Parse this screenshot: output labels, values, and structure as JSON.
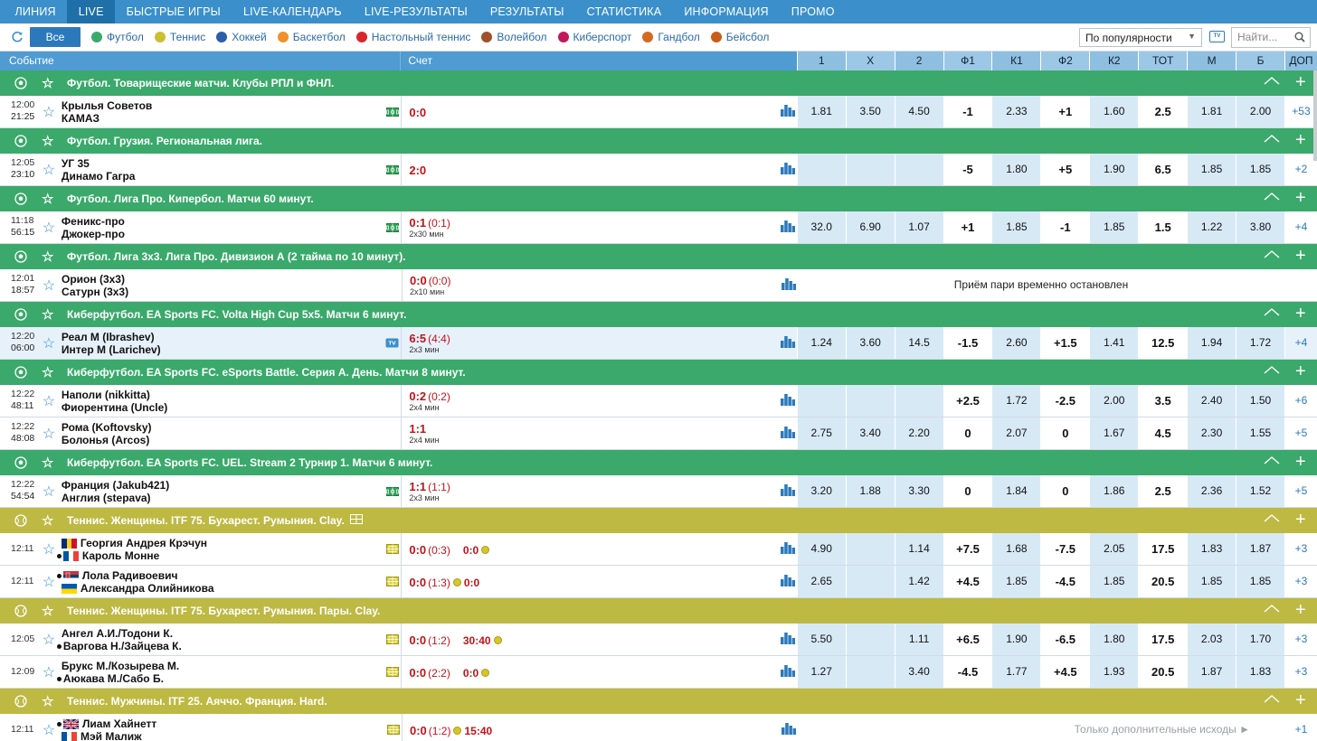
{
  "nav": {
    "items": [
      "ЛИНИЯ",
      "LIVE",
      "БЫСТРЫЕ ИГРЫ",
      "LIVE-КАЛЕНДАРЬ",
      "LIVE-РЕЗУЛЬТАТЫ",
      "РЕЗУЛЬТАТЫ",
      "СТАТИСТИКА",
      "ИНФОРМАЦИЯ",
      "ПРОМО"
    ],
    "active_index": 1
  },
  "filters": {
    "all_label": "Все",
    "sports": [
      {
        "label": "Футбол",
        "icon": "football-icon",
        "color": "#3aa96b"
      },
      {
        "label": "Теннис",
        "icon": "tennis-icon",
        "color": "#c8c032"
      },
      {
        "label": "Хоккей",
        "icon": "hockey-icon",
        "color": "#2b5ea8"
      },
      {
        "label": "Баскетбол",
        "icon": "basketball-icon",
        "color": "#f0902a"
      },
      {
        "label": "Настольный теннис",
        "icon": "table-tennis-icon",
        "color": "#d8262d"
      },
      {
        "label": "Волейбол",
        "icon": "volleyball-icon",
        "color": "#a0502a"
      },
      {
        "label": "Киберспорт",
        "icon": "esports-icon",
        "color": "#c2185b"
      },
      {
        "label": "Гандбол",
        "icon": "handball-icon",
        "color": "#d36a1f"
      },
      {
        "label": "Бейсбол",
        "icon": "baseball-icon",
        "color": "#c75d19"
      }
    ],
    "sort_value": "По популярности",
    "search_placeholder": "Найти...",
    "tv_label": "TV"
  },
  "columns": {
    "event": "Событие",
    "score": "Счет",
    "odds": [
      "1",
      "X",
      "2",
      "Ф1",
      "К1",
      "Ф2",
      "К2",
      "ТОТ",
      "М",
      "Б"
    ],
    "dop": "ДОП"
  },
  "groups": [
    {
      "type": "football",
      "title": "Футбол. Товарищеские матчи. Клубы РПЛ и ФНЛ.",
      "rows": [
        {
          "t1": "12:00",
          "t2": "21:25",
          "team1": "Крылья Советов",
          "team2": "КАМАЗ",
          "score": "0:0",
          "score_extra": "",
          "sub": "",
          "icon": "field",
          "odds": [
            "1.81",
            "3.50",
            "4.50",
            "-1",
            "2.33",
            "+1",
            "1.60",
            "2.5",
            "1.81",
            "2.00"
          ],
          "dop": "+53"
        }
      ]
    },
    {
      "type": "football",
      "title": "Футбол. Грузия. Региональная лига.",
      "rows": [
        {
          "t1": "12:05",
          "t2": "23:10",
          "team1": "УГ 35",
          "team2": "Динамо Гагра",
          "score": "2:0",
          "score_extra": "",
          "sub": "",
          "icon": "field",
          "odds": [
            "",
            "",
            "",
            "-5",
            "1.80",
            "+5",
            "1.90",
            "6.5",
            "1.85",
            "1.85"
          ],
          "dop": "+2"
        }
      ]
    },
    {
      "type": "football",
      "title": "Футбол. Лига Про. Кипербол. Матчи 60 минут.",
      "rows": [
        {
          "t1": "11:18",
          "t2": "56:15",
          "team1": "Феникс-про",
          "team2": "Джокер-про",
          "score": "0:1",
          "score_extra": "(0:1)",
          "sub": "2x30 мин",
          "icon": "field",
          "odds": [
            "32.0",
            "6.90",
            "1.07",
            "+1",
            "1.85",
            "-1",
            "1.85",
            "1.5",
            "1.22",
            "3.80"
          ],
          "dop": "+4"
        }
      ]
    },
    {
      "type": "football",
      "title": "Футбол. Лига 3х3. Лига Про. Дивизион А (2 тайма по 10 минут).",
      "rows": [
        {
          "t1": "12:01",
          "t2": "18:57",
          "team1": "Орион (3х3)",
          "team2": "Сатурн (3х3)",
          "score": "0:0",
          "score_extra": "(0:0)",
          "sub": "2x10 мин",
          "icon": "",
          "message": "Приём пари временно остановлен",
          "dop": ""
        }
      ]
    },
    {
      "type": "football",
      "title": "Киберфутбол. EA Sports FC. Volta High Cup 5x5. Матчи 6 минут.",
      "rows": [
        {
          "t1": "12:20",
          "t2": "06:00",
          "team1": "Реал М (Ibrashev)",
          "team2": "Интер М (Larichev)",
          "score": "6:5",
          "score_extra": "(4:4)",
          "sub": "2x3 мин",
          "icon": "tv",
          "highlight": true,
          "odds": [
            "1.24",
            "3.60",
            "14.5",
            "-1.5",
            "2.60",
            "+1.5",
            "1.41",
            "12.5",
            "1.94",
            "1.72"
          ],
          "dop": "+4"
        }
      ]
    },
    {
      "type": "football",
      "title": "Киберфутбол. EA Sports FC. eSports Battle. Серия А. День. Матчи 8 минут.",
      "rows": [
        {
          "t1": "12:22",
          "t2": "48:11",
          "team1": "Наполи (nikkitta)",
          "team2": "Фиорентина (Uncle)",
          "score": "0:2",
          "score_extra": "(0:2)",
          "sub": "2x4 мин",
          "icon": "",
          "odds": [
            "",
            "",
            "",
            "+2.5",
            "1.72",
            "-2.5",
            "2.00",
            "3.5",
            "2.40",
            "1.50"
          ],
          "dop": "+6"
        },
        {
          "t1": "12:22",
          "t2": "48:08",
          "team1": "Рома (Koftovsky)",
          "team2": "Болонья (Arcos)",
          "score": "1:1",
          "score_extra": "",
          "sub": "2x4 мин",
          "icon": "",
          "odds": [
            "2.75",
            "3.40",
            "2.20",
            "0",
            "2.07",
            "0",
            "1.67",
            "4.5",
            "2.30",
            "1.55"
          ],
          "dop": "+5"
        }
      ]
    },
    {
      "type": "football",
      "title": "Киберфутбол. EA Sports FC. UEL. Stream 2 Турнир 1. Матчи 6 минут.",
      "rows": [
        {
          "t1": "12:22",
          "t2": "54:54",
          "team1": "Франция (Jakub421)",
          "team2": "Англия (stepava)",
          "score": "1:1",
          "score_extra": "(1:1)",
          "sub": "2x3 мин",
          "icon": "field",
          "odds": [
            "3.20",
            "1.88",
            "3.30",
            "0",
            "1.84",
            "0",
            "1.86",
            "2.5",
            "2.36",
            "1.52"
          ],
          "dop": "+5"
        }
      ]
    },
    {
      "type": "tennis",
      "title": "Теннис. Женщины. ITF 75. Бухарест. Румыния. Clay.",
      "rows": [
        {
          "t1": "12:11",
          "t2": "",
          "team1": "Георгия Андрея Крэчун",
          "team2": "Кароль Монне",
          "flag1": "ro",
          "flag2": "fr",
          "serve": 2,
          "score": "0:0",
          "score_extra": "(0:3)",
          "game": "0:0",
          "game_ball": true,
          "sub": "",
          "icon": "court",
          "odds": [
            "4.90",
            "",
            "1.14",
            "+7.5",
            "1.68",
            "-7.5",
            "2.05",
            "17.5",
            "1.83",
            "1.87"
          ],
          "dop": "+3"
        },
        {
          "t1": "12:11",
          "t2": "",
          "team1": "Лола Радивоевич",
          "team2": "Александра Олийникова",
          "flag1": "rs",
          "flag2": "ua",
          "serve": 1,
          "score": "0:0",
          "score_extra": "(1:3)",
          "game": "0:0",
          "game_ball_before": true,
          "sub": "",
          "icon": "court",
          "odds": [
            "2.65",
            "",
            "1.42",
            "+4.5",
            "1.85",
            "-4.5",
            "1.85",
            "20.5",
            "1.85",
            "1.85"
          ],
          "dop": "+3"
        }
      ]
    },
    {
      "type": "tennis",
      "title": "Теннис. Женщины. ITF 75. Бухарест. Румыния. Пары. Clay.",
      "rows": [
        {
          "t1": "12:05",
          "t2": "",
          "team1": "Ангел А.И./Тодони К.",
          "team2": "Варгова Н./Зайцева К.",
          "serve": 2,
          "score": "0:0",
          "score_extra": "(1:2)",
          "game": "30:40",
          "game_ball": true,
          "sub": "",
          "icon": "court",
          "odds": [
            "5.50",
            "",
            "1.11",
            "+6.5",
            "1.90",
            "-6.5",
            "1.80",
            "17.5",
            "2.03",
            "1.70"
          ],
          "dop": "+3"
        },
        {
          "t1": "12:09",
          "t2": "",
          "team1": "Брукс М./Козырева М.",
          "team2": "Аюкава М./Сабо Б.",
          "serve": 2,
          "score": "0:0",
          "score_extra": "(2:2)",
          "game": "0:0",
          "game_ball": true,
          "sub": "",
          "icon": "court",
          "odds": [
            "1.27",
            "",
            "3.40",
            "-4.5",
            "1.77",
            "+4.5",
            "1.93",
            "20.5",
            "1.87",
            "1.83"
          ],
          "dop": "+3"
        }
      ]
    },
    {
      "type": "tennis",
      "title": "Теннис. Мужчины. ITF 25. Аяччо. Франция. Hard.",
      "rows": [
        {
          "t1": "12:11",
          "t2": "",
          "team1": "Лиам Хайнетт",
          "team2": "Мэй Малиж",
          "flag1": "gb",
          "flag2": "fr",
          "serve": 1,
          "score": "0:0",
          "score_extra": "(1:2)",
          "game": "15:40",
          "game_ball_before": true,
          "sub": "",
          "icon": "court",
          "message2": "Только дополнительные исходы ►",
          "dop": "+1"
        }
      ]
    }
  ],
  "colors": {
    "nav_bg": "#3b8fca",
    "football_group": "#3aa96b",
    "tennis_group": "#bdb943",
    "score_red": "#c0141b",
    "odds_bg": "#d8e9f6"
  }
}
